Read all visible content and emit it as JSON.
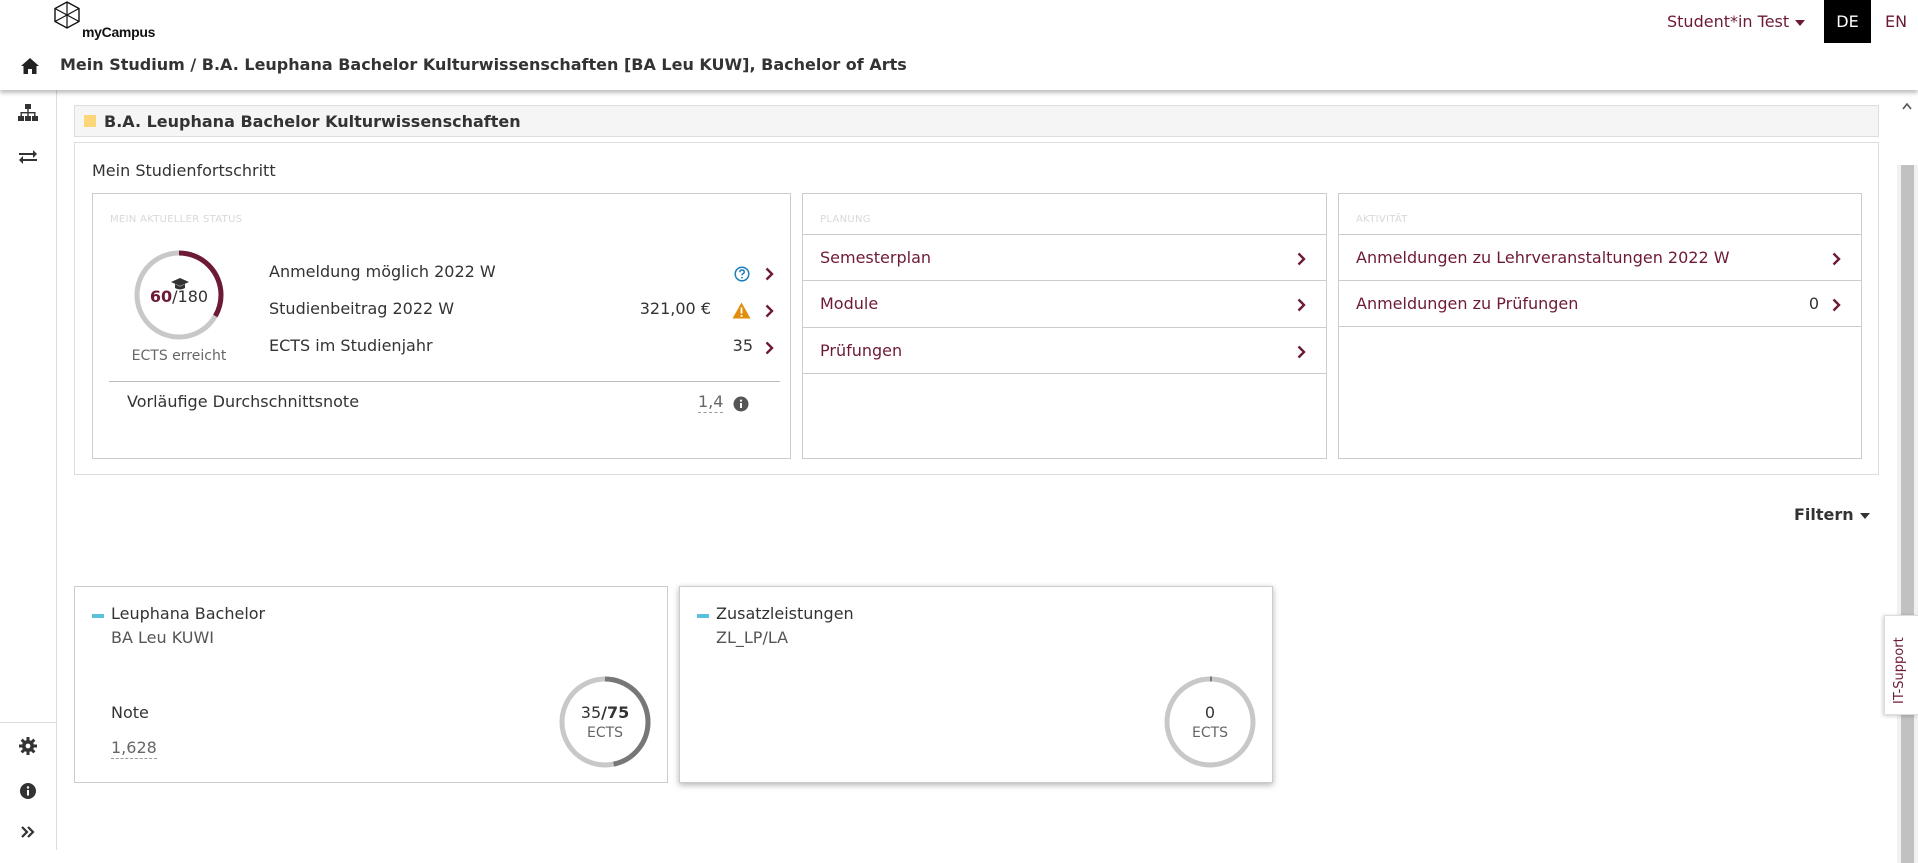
{
  "app": {
    "name": "myCampus"
  },
  "header": {
    "breadcrumb": "Mein Studium / B.A. Leuphana Bachelor Kulturwissenschaften [BA Leu KUW], Bachelor of Arts",
    "user_label": "Student*in Test",
    "lang_de": "DE",
    "lang_en": "EN"
  },
  "sidebar": {
    "icons": [
      "sitemap-icon",
      "exchange-icon",
      "gear-icon",
      "info-icon",
      "double-chevron-right-icon"
    ]
  },
  "program": {
    "title": "B.A. Leuphana Bachelor Kulturwissenschaften"
  },
  "progress": {
    "title": "Mein Studienfortschritt",
    "status": {
      "label": "MEIN AKTUELLER STATUS",
      "gauge_achieved": "60",
      "gauge_total": "/180",
      "gauge_fraction": 0.333,
      "gauge_caption": "ECTS erreicht",
      "rows": [
        {
          "label": "Anmeldung möglich 2022 W",
          "value": ""
        },
        {
          "label": "Studienbeitrag 2022 W",
          "value": "321,00 €"
        },
        {
          "label": "ECTS im Studienjahr",
          "value": "35"
        }
      ],
      "average_label": "Vorläufige Durchschnittsnote",
      "average_value": "1,4"
    },
    "planning": {
      "label": "PLANUNG",
      "links": [
        "Semesterplan",
        "Module",
        "Prüfungen"
      ]
    },
    "activity": {
      "label": "AKTIVITÄT",
      "links": [
        {
          "label": "Anmeldungen zu Lehrveranstaltungen 2022 W",
          "count": ""
        },
        {
          "label": "Anmeldungen zu Prüfungen",
          "count": "0"
        }
      ]
    }
  },
  "filter": {
    "label": "Filtern"
  },
  "cards": [
    {
      "title": "Leuphana Bachelor",
      "code": "BA Leu KUWI",
      "note_label": "Note",
      "note_value": "1,628",
      "ects_achieved": "35",
      "ects_total": "/75",
      "ects_unit": "ECTS",
      "fraction": 0.467
    },
    {
      "title": "Zusatzleistungen",
      "code": "ZL_LP/LA",
      "ects_achieved": "0",
      "ects_unit": "ECTS",
      "fraction": 0.0
    }
  ],
  "it_support": {
    "label": "IT-Support"
  },
  "colors": {
    "brand": "#6d1a36",
    "accent_bar": "#5bc0de",
    "program_square": "#fbd77a",
    "warning": "#e08e0b"
  }
}
